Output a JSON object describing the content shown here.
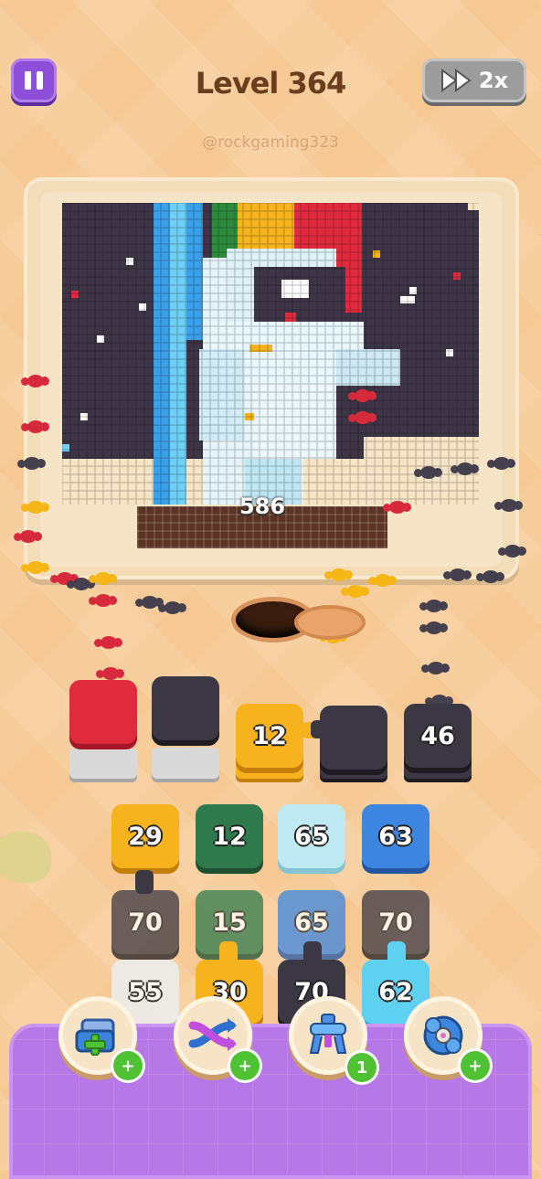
{
  "header": {
    "level_title": "Level 364",
    "speed_label": "2x",
    "watermark": "@rockgaming323"
  },
  "board": {
    "remaining_count": "586"
  },
  "slots": [
    {
      "color": "red",
      "count": ""
    },
    {
      "color": "dark",
      "count": ""
    },
    {
      "color": "yellow",
      "count": "12"
    },
    {
      "color": "dark",
      "count": ""
    },
    {
      "color": "dark",
      "count": "46"
    }
  ],
  "queue": {
    "row1": [
      {
        "color": "yellow",
        "count": "29"
      },
      {
        "color": "green",
        "count": "12"
      },
      {
        "color": "lightblue",
        "count": "65"
      },
      {
        "color": "blue",
        "count": "63"
      }
    ],
    "row2": [
      {
        "color": "dark",
        "count": "70"
      },
      {
        "color": "green",
        "count": "15"
      },
      {
        "color": "blue",
        "count": "65"
      },
      {
        "color": "dark",
        "count": "70"
      }
    ],
    "row3": [
      {
        "color": "white",
        "count": "55"
      },
      {
        "color": "yellow",
        "count": "30"
      },
      {
        "color": "dark",
        "count": "70"
      },
      {
        "color": "cyan",
        "count": "62"
      }
    ]
  },
  "boosters": [
    {
      "name": "add-slot",
      "badge": "+"
    },
    {
      "name": "shuffle",
      "badge": "+"
    },
    {
      "name": "claw",
      "badge": "1"
    },
    {
      "name": "magnet",
      "badge": "+"
    }
  ],
  "colors": {
    "red": "#e02b3f",
    "dark": "#3c3843",
    "yellow": "#f6b31d",
    "green": "#2f7a4c",
    "lightblue": "#bfe9f2",
    "blue": "#3c86e0",
    "cyan": "#5fd1f0",
    "white": "#ececec",
    "tray_purple": "#b678e6"
  }
}
